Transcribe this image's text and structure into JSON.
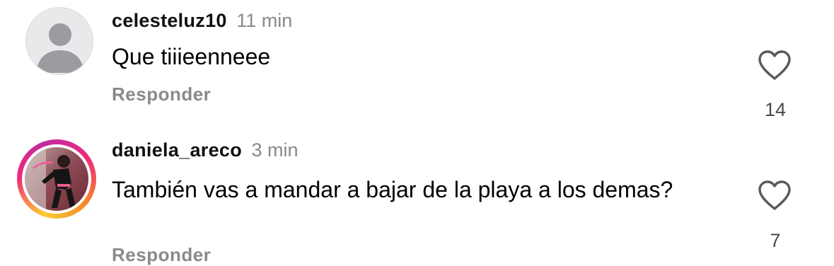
{
  "comments": [
    {
      "username": "celesteluz10",
      "time": "11 min",
      "text": "Que tiiieenneee",
      "reply_label": "Responder",
      "likes": "14",
      "avatar_icon": "default-avatar-icon",
      "like_icon": "heart-outline-icon"
    },
    {
      "username": "daniela_areco",
      "time": "3 min",
      "text": "También vas a mandar a bajar de la playa a los demas?",
      "reply_label": "Responder",
      "likes": "7",
      "avatar_icon": "profile-photo",
      "like_icon": "heart-outline-icon"
    }
  ],
  "colors": {
    "secondary_text": "#8a8a8e",
    "story_ring_start": "#f9ce34",
    "story_ring_mid": "#ee2a7b",
    "story_ring_end": "#c32aa3"
  }
}
